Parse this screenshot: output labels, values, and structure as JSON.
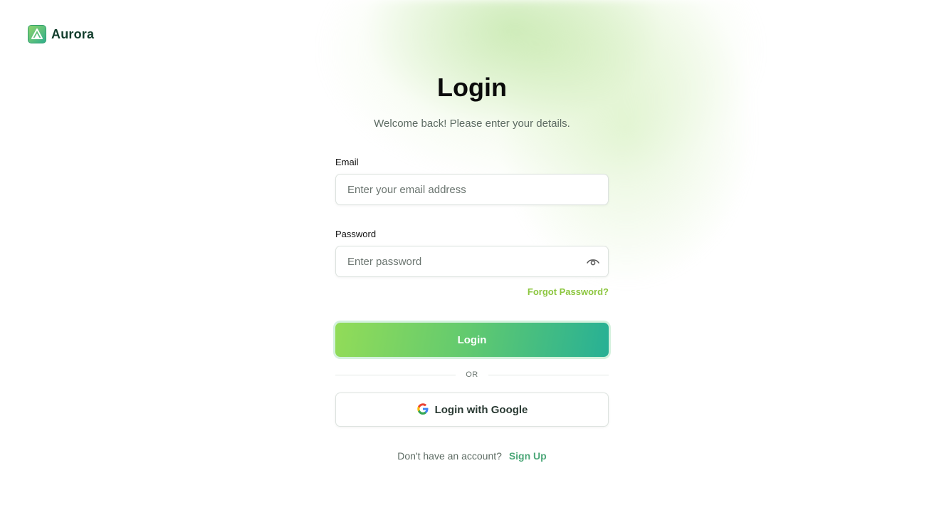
{
  "brand": {
    "name": "Aurora",
    "icon": "aurora-logo-icon"
  },
  "header": {
    "title": "Login",
    "subtitle": "Welcome back! Please enter your details."
  },
  "form": {
    "email": {
      "label": "Email",
      "placeholder": "Enter your email address",
      "value": ""
    },
    "password": {
      "label": "Password",
      "placeholder": "Enter password",
      "value": "",
      "toggle_icon": "eye-icon"
    },
    "forgot_link": "Forgot Password?",
    "submit_label": "Login",
    "divider_text": "OR",
    "google_label": "Login with Google",
    "google_icon": "google-icon"
  },
  "footer": {
    "prompt": "Don't have an account?",
    "signup_link": "Sign Up"
  },
  "colors": {
    "accent_start": "#92dc58",
    "accent_end": "#27b095",
    "link_green": "#8cc63f",
    "signup_green": "#4ea87a"
  }
}
